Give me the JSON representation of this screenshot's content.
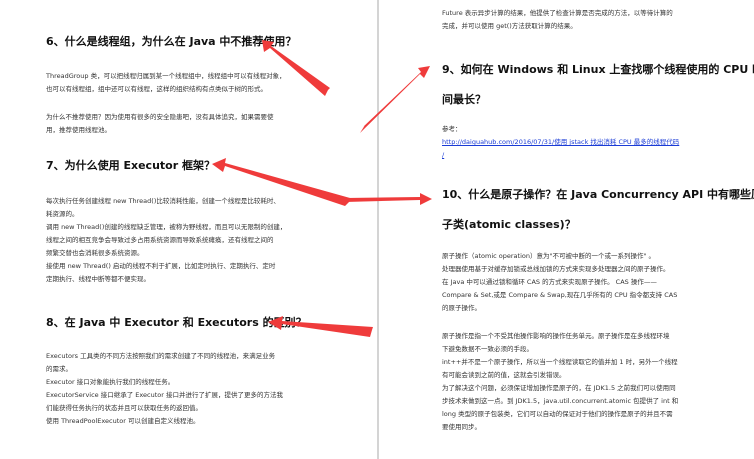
{
  "left": {
    "q6": {
      "title": "6、什么是线程组，为什么在 Java 中不推荐使用？",
      "p1": [
        "ThreadGroup 类，可以把线程归属到某一个线程组中，线程组中可以有线程对象，",
        "也可以有线程组，组中还可以有线程，这样的组织结构有点类似于树的形式。"
      ],
      "p2": [
        "为什么不推荐使用？因为使用有很多的安全隐患吧，没有具体追究，如果需要使",
        "用，推荐使用线程池。"
      ]
    },
    "q7": {
      "title": "7、为什么使用 Executor 框架？",
      "lines": [
        "每次执行任务创建线程   new Thread()比较消耗性能，创建一个线程是比较耗时、",
        "耗资源的。",
        "调用   new Thread()创建的线程缺乏管理，被称为野线程，而且可以无限制的创建，",
        "线程之间的相互竞争会导致过多占用系统资源而导致系统瘫痪，还有线程之间的",
        "频繁交替也会消耗很多系统资源。",
        "接使用 new Thread()  启动的线程不利于扩展，比如定时执行、定期执行、定时",
        "定期执行、线程中断等都不便实现。"
      ]
    },
    "q8": {
      "title": "8、在 Java 中 Executor 和 Executors 的区别？",
      "lines": [
        "Executors  工具类的不同方法按照我们的需求创建了不同的线程池，来满足业务",
        "的需求。",
        "Executor  接口对象能执行我们的线程任务。",
        "ExecutorService 接口继承了 Executor 接口并进行了扩展，提供了更多的方法我",
        "们能获得任务执行的状态并且可以获取任务的返回值。",
        "使用 ThreadPoolExecutor  可以创建自定义线程池。"
      ]
    }
  },
  "right": {
    "top_lines": [
      "Future  表示异步计算的结果，他提供了检查计算是否完成的方法，以等待计算的",
      "完成，并可以使用 get()方法获取计算的结果。"
    ],
    "q9": {
      "title_lines": [
        "9、如何在 Windows 和 Linux 上查找哪个线程使用的 CPU 时",
        "间最长？"
      ],
      "ref_label": "参考：",
      "ref_link": "http://daiguahub.com/2016/07/31/使用 jstack 找出消耗 CPU 最多的线程代码",
      "ref_link_end": "/"
    },
    "q10": {
      "title_lines": [
        "10、什么是原子操作？在 Java Concurrency API 中有哪些原",
        "子类(atomic classes)？"
      ],
      "block1": [
        "原子操作（atomic operation）意为\"不可被中断的一个或一系列操作\"   。",
        "处理器使用基于对缓存加锁或总线加锁的方式来实现多处理器之间的原子操作。",
        "在 Java 中可以通过锁和循环 CAS 的方式来实现原子操作。  CAS 操作——",
        "Compare & Set,或是  Compare & Swap,现在几乎所有的 CPU 指令都支持 CAS",
        "的原子操作。"
      ],
      "block2": [
        "原子操作是指一个不受其他操作影响的操作任务单元。原子操作是在多线程环境",
        "下避免数据不一致必须的手段。",
        "int++并不是一个原子操作，所以当一个线程读取它的值并加 1 时，另外一个线程",
        "有可能会读到之前的值，这就会引发错误。",
        "为了解决这个问题，必须保证增加操作是原子的，在 JDK1.5 之前我们可以使用同",
        "步技术来做到这一点。到 JDK1.5，java.util.concurrent.atomic 包提供了 int 和",
        "long 类型的原子包装类，它们可以自动的保证对于他们的操作是原子的并且不需",
        "要使用同步。"
      ]
    }
  },
  "colors": {
    "arrow": "#ef3b3b",
    "link": "#1a3bd6",
    "text": "#333333"
  },
  "icons": [
    "red-arrow-icon"
  ]
}
